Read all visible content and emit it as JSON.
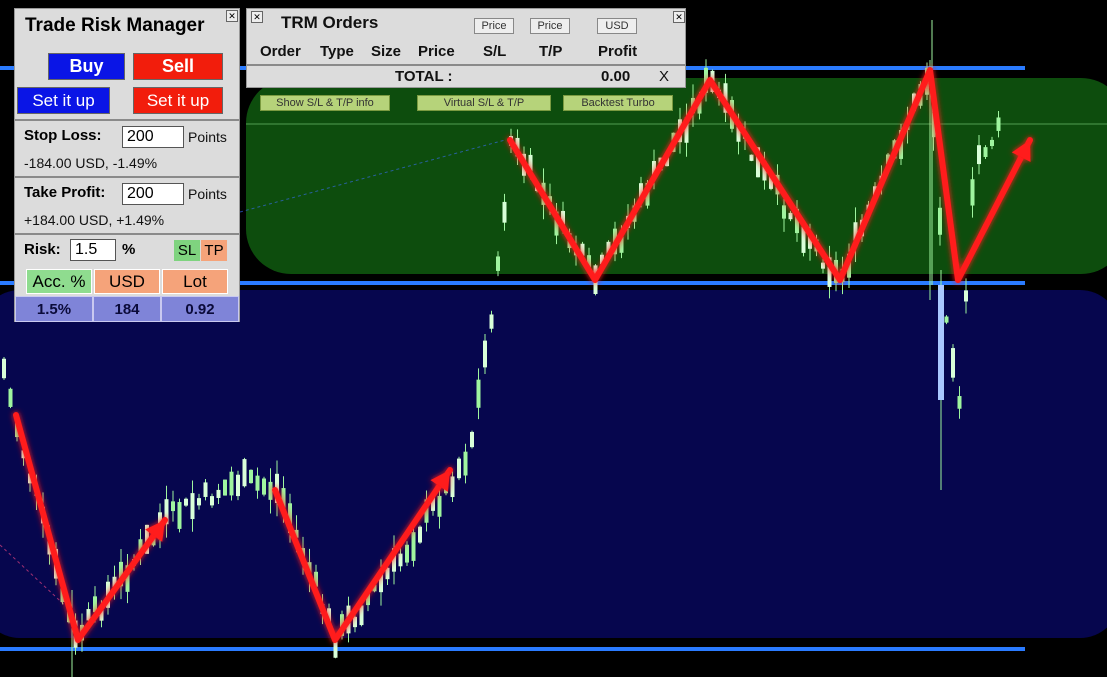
{
  "trade_risk_manager": {
    "title": "Trade Risk Manager",
    "buy_label": "Buy",
    "sell_label": "Sell",
    "setup_buy_label": "Set it up",
    "setup_sell_label": "Set it up",
    "stop_loss": {
      "label": "Stop Loss:",
      "value": "200",
      "unit": "Points",
      "summary": "-184.00 USD, -1.49%"
    },
    "take_profit": {
      "label": "Take Profit:",
      "value": "200",
      "unit": "Points",
      "summary": "+184.00 USD, +1.49%"
    },
    "risk": {
      "label": "Risk:",
      "value": "1.5",
      "unit": "%",
      "sl_toggle": "SL",
      "tp_toggle": "TP"
    },
    "mode_tabs": [
      "Acc. %",
      "USD",
      "Lot"
    ],
    "mode_values": [
      "1.5%",
      "184",
      "0.92"
    ]
  },
  "trm_orders": {
    "title": "TRM Orders",
    "header_buttons": [
      "Price",
      "Price",
      "USD"
    ],
    "columns": [
      "Order",
      "Type",
      "Size",
      "Price",
      "S/L",
      "T/P",
      "Profit"
    ],
    "total_label": "TOTAL :",
    "total_value": "0.00",
    "close_all_label": "X",
    "action_buttons": [
      "Show S/L & T/P info",
      "Virtual S/L & T/P",
      "Backtest Turbo"
    ]
  },
  "close_glyph": "✕",
  "colors": {
    "buy": "#0a15e6",
    "sell": "#f21d0c",
    "resistance_zone": "#0d4d0d",
    "support_zone": "#06064e",
    "level_line": "#2a7bff",
    "arrow": "#ff1a1a",
    "candle": "#9ff59f"
  },
  "icons": [
    "close-icon",
    "window-close-icon",
    "arrow-up-right-icon"
  ]
}
